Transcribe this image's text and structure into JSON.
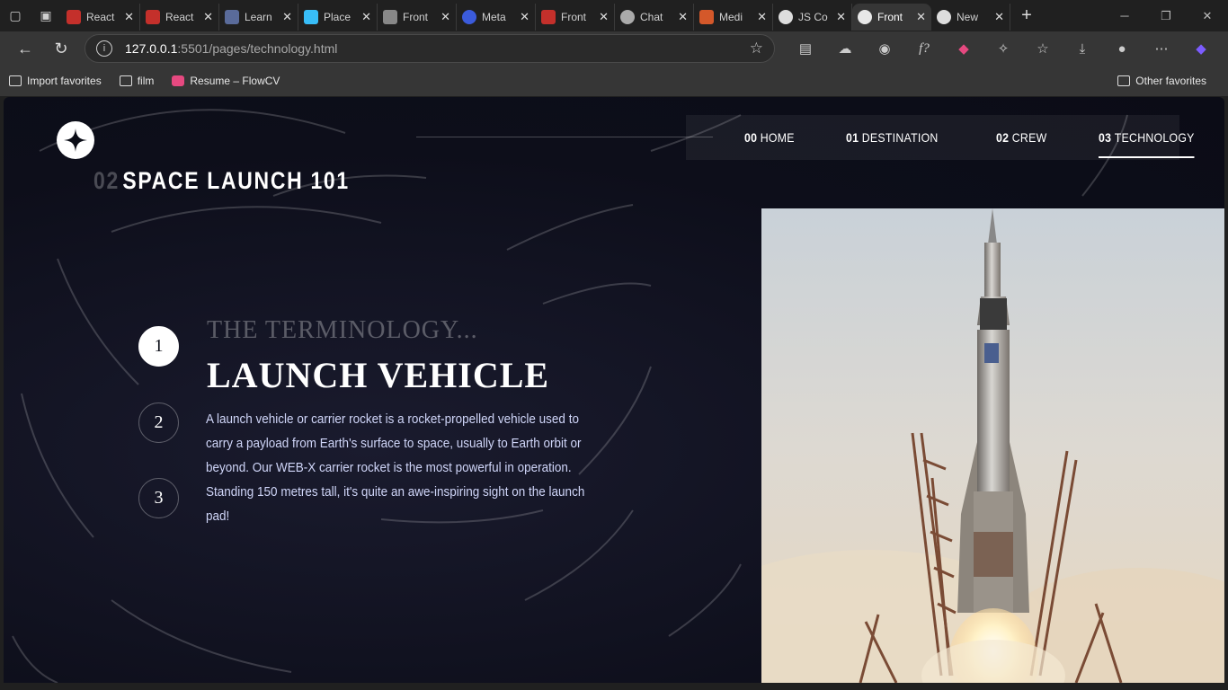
{
  "browser": {
    "tabs": [
      {
        "title": "React",
        "color": "#c4302b"
      },
      {
        "title": "React",
        "color": "#c4302b"
      },
      {
        "title": "Learn",
        "color": "#5a6b9a"
      },
      {
        "title": "Place",
        "color": "#38bdf8"
      },
      {
        "title": "Front",
        "color": "#888888"
      },
      {
        "title": "Meta",
        "color": "#3b5bdb"
      },
      {
        "title": "Front",
        "color": "#c4302b"
      },
      {
        "title": "Chat",
        "color": "#aaaaaa"
      },
      {
        "title": "Medi",
        "color": "#d4582a"
      },
      {
        "title": "JS Co",
        "color": "#dddddd"
      },
      {
        "title": "Front",
        "color": "#e8e8e8",
        "active": true
      },
      {
        "title": "New",
        "color": "#dddddd"
      }
    ],
    "url_host": "127.0.0.1",
    "url_path": ":5501/pages/technology.html",
    "favorites": [
      "Import favorites",
      "film",
      "Resume – FlowCV"
    ],
    "other_favorites": "Other favorites"
  },
  "site": {
    "nav": [
      {
        "num": "00",
        "label": "HOME"
      },
      {
        "num": "01",
        "label": "DESTINATION"
      },
      {
        "num": "02",
        "label": "CREW"
      },
      {
        "num": "03",
        "label": "TECHNOLOGY",
        "active": true
      }
    ],
    "subhead_num": "02",
    "subhead_text": "SPACE LAUNCH 101",
    "steps": [
      "1",
      "2",
      "3"
    ],
    "terminology": "THE TERMINOLOGY...",
    "title": "LAUNCH VEHICLE",
    "description": "A launch vehicle or carrier rocket is a rocket-propelled vehicle used to carry a payload from Earth's surface to space, usually to Earth orbit or beyond. Our WEB-X carrier rocket is the most powerful in operation. Standing 150 metres tall, it's quite an awe-inspiring sight on the launch pad!"
  }
}
